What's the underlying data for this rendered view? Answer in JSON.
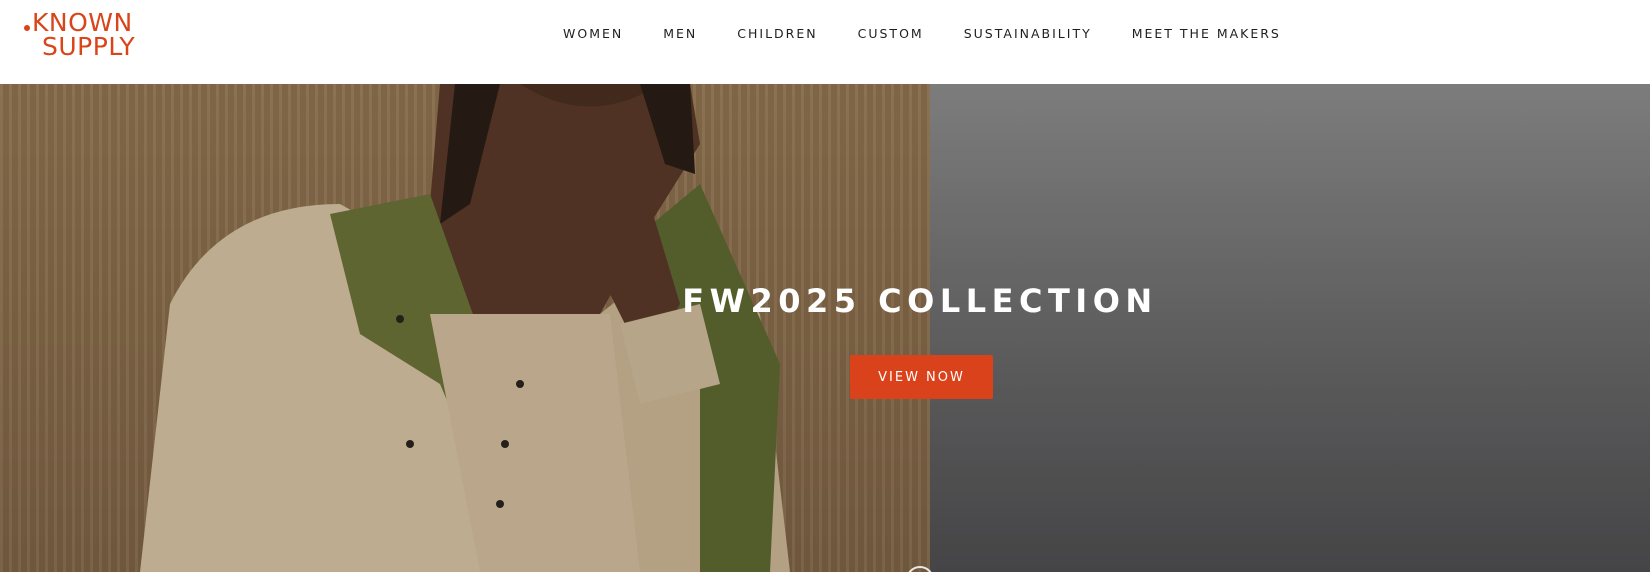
{
  "header": {
    "logo": {
      "line1": "KNOWN",
      "line2": "SUPPLY",
      "brand_color": "#d9441a"
    },
    "nav": {
      "items": [
        {
          "label": "WOMEN"
        },
        {
          "label": "MEN"
        },
        {
          "label": "CHILDREN"
        },
        {
          "label": "CUSTOM"
        },
        {
          "label": "SUSTAINABILITY"
        },
        {
          "label": "MEET THE MAKERS"
        }
      ]
    }
  },
  "hero": {
    "title": "FW2025 COLLECTION",
    "cta_label": "VIEW NOW",
    "cta_color": "#d9421a",
    "image_description_icon": "model-photo"
  }
}
